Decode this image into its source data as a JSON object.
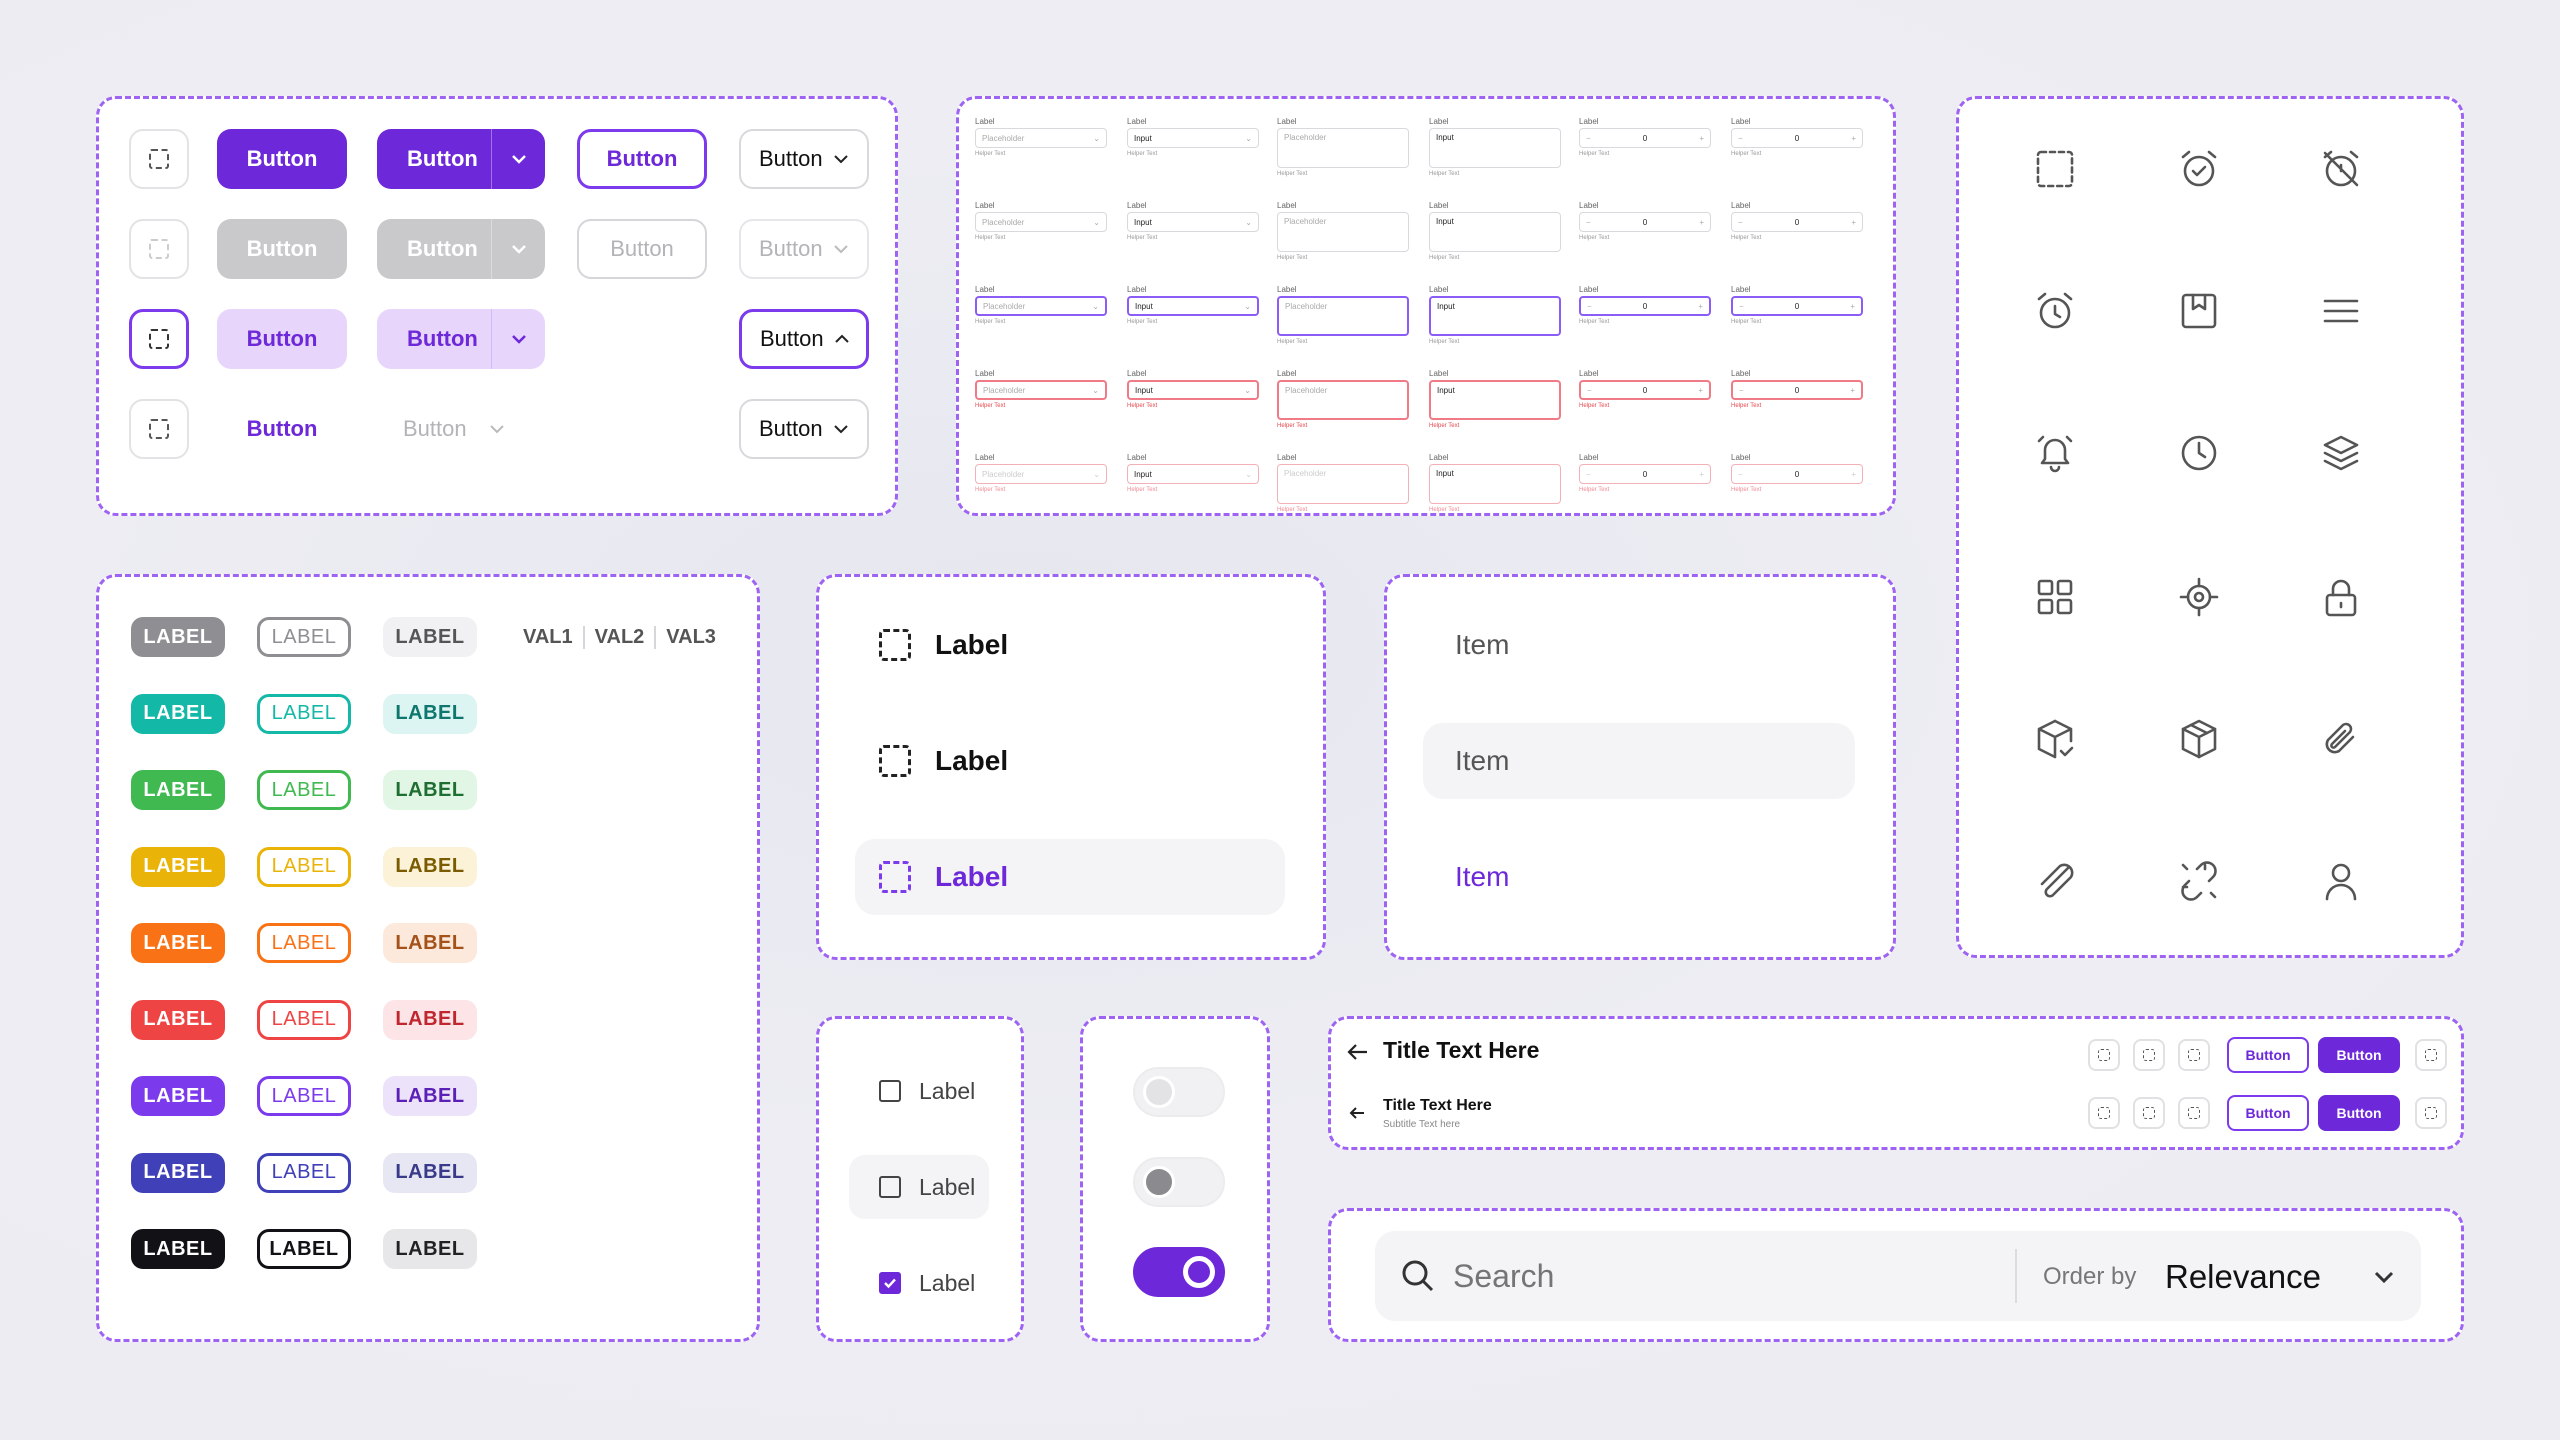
{
  "buttons": {
    "label": "Button"
  },
  "labels": {
    "tag": "LABEL",
    "segments": [
      "VAL1",
      "VAL2",
      "VAL3"
    ],
    "colors": [
      "#8e8e93",
      "#14b8a6",
      "#3fb950",
      "#eab308",
      "#f97316",
      "#ef4444",
      "#7c3aed",
      "#4040b8",
      "#111116"
    ],
    "outline_colors": [
      "#8e8e93",
      "#14b8a6",
      "#3fb950",
      "#eab308",
      "#f97316",
      "#ef4444",
      "#7c3aed",
      "#4040b8",
      "#111116"
    ],
    "soft_backgrounds": [
      "#f1f1f3",
      "#dcf5f2",
      "#e2f6e6",
      "#fbf2d8",
      "#fde9dc",
      "#fde4e6",
      "#ece3fb",
      "#e6e7f3",
      "#e7e7e9"
    ],
    "soft_text": [
      "#555",
      "#0f766e",
      "#1f6f32",
      "#7a5b00",
      "#a4511a",
      "#c0262d",
      "#5b21b6",
      "#3a3a8a",
      "#222"
    ]
  },
  "inputs": {
    "label": "Label",
    "placeholder": "Placeholder",
    "value": "Input",
    "helper": "Helper Text",
    "stepper_value": "0"
  },
  "list_labels": {
    "text": "Label"
  },
  "list_items": {
    "text": "Item"
  },
  "icons": [
    "dashed-square-icon",
    "alarm-check-icon",
    "alarm-off-icon",
    "alarm-icon",
    "bookmark-square-icon",
    "menu-icon",
    "bell-ringing-icon",
    "clock-icon",
    "layers-icon",
    "grid-icon",
    "target-icon",
    "lock-icon",
    "package-check-icon",
    "package-icon",
    "paperclip-icon",
    "paperclip-alt-icon",
    "broken-link-icon",
    "user-icon"
  ],
  "checkboxes": {
    "label": "Label"
  },
  "header": {
    "title": "Title Text Here",
    "title_small": "Title Text Here",
    "subtitle": "Subtitle Text here",
    "button": "Button"
  },
  "search": {
    "placeholder": "Search",
    "order_label": "Order by",
    "order_value": "Relevance"
  },
  "accent": "#6d28d9"
}
